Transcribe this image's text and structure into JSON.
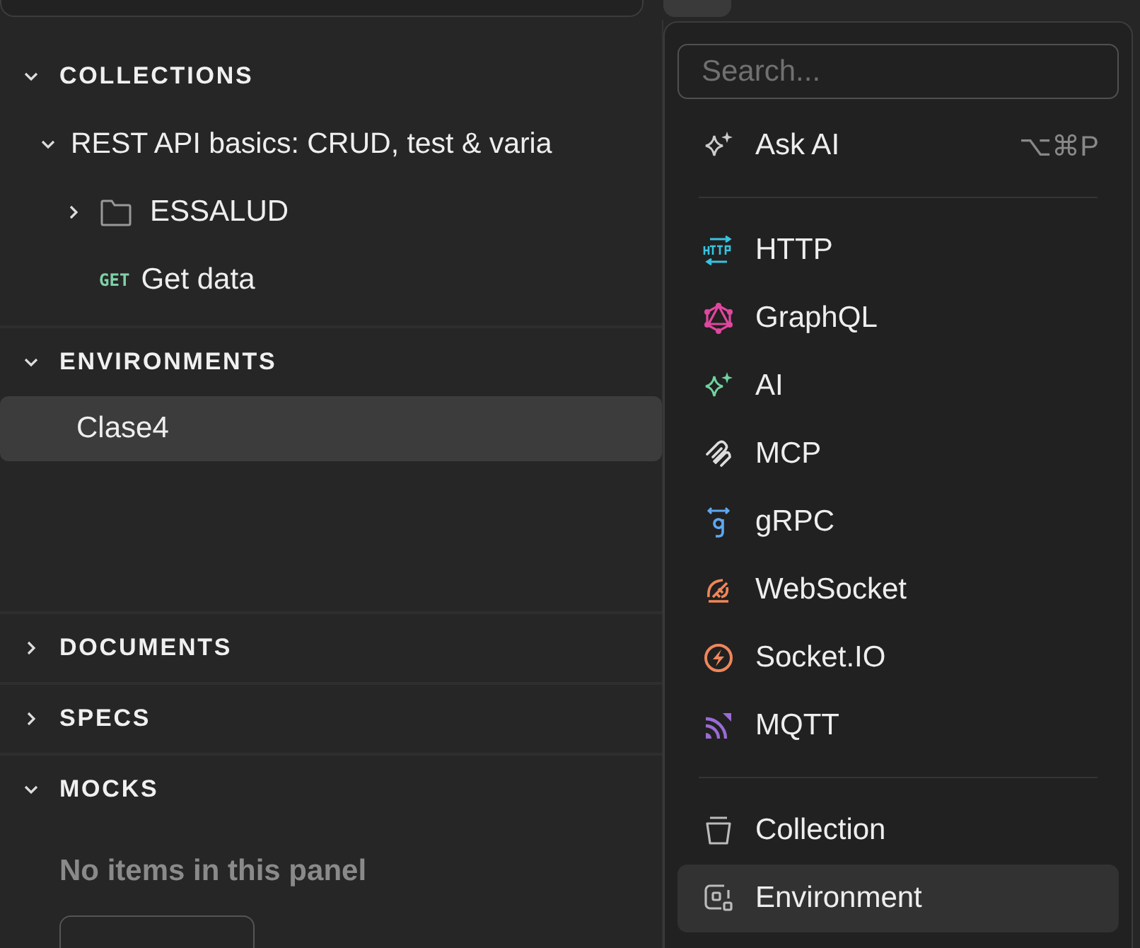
{
  "sidebar": {
    "sections": [
      {
        "title": "COLLECTIONS",
        "expanded": true,
        "tree": [
          {
            "kind": "collection",
            "label": "REST API basics: CRUD, test & varia",
            "expanded": true,
            "children": [
              {
                "kind": "folder",
                "label": "ESSALUD",
                "expanded": false
              },
              {
                "kind": "request",
                "method": "GET",
                "label": "Get data"
              }
            ]
          }
        ]
      },
      {
        "title": "ENVIRONMENTS",
        "expanded": true,
        "items": [
          {
            "label": "Clase4",
            "selected": true
          }
        ]
      },
      {
        "title": "DOCUMENTS",
        "expanded": false
      },
      {
        "title": "SPECS",
        "expanded": false
      },
      {
        "title": "MOCKS",
        "expanded": true,
        "empty_message": "No items in this panel"
      }
    ]
  },
  "menu": {
    "search": {
      "placeholder": "Search..."
    },
    "groups": [
      [
        {
          "kind": "sparkle",
          "label": "Ask AI",
          "shortcut": "⌥⌘P",
          "selected": false
        }
      ],
      [
        {
          "kind": "http",
          "label": "HTTP",
          "selected": false
        },
        {
          "kind": "graphql",
          "label": "GraphQL",
          "selected": false
        },
        {
          "kind": "ai",
          "label": "AI",
          "selected": false
        },
        {
          "kind": "mcp",
          "label": "MCP",
          "selected": false
        },
        {
          "kind": "grpc",
          "label": "gRPC",
          "selected": false
        },
        {
          "kind": "websocket",
          "label": "WebSocket",
          "selected": false
        },
        {
          "kind": "socketio",
          "label": "Socket.IO",
          "selected": false
        },
        {
          "kind": "mqtt",
          "label": "MQTT",
          "selected": false
        }
      ],
      [
        {
          "kind": "collection",
          "label": "Collection",
          "selected": false
        },
        {
          "kind": "environment",
          "label": "Environment",
          "selected": true
        }
      ]
    ]
  }
}
